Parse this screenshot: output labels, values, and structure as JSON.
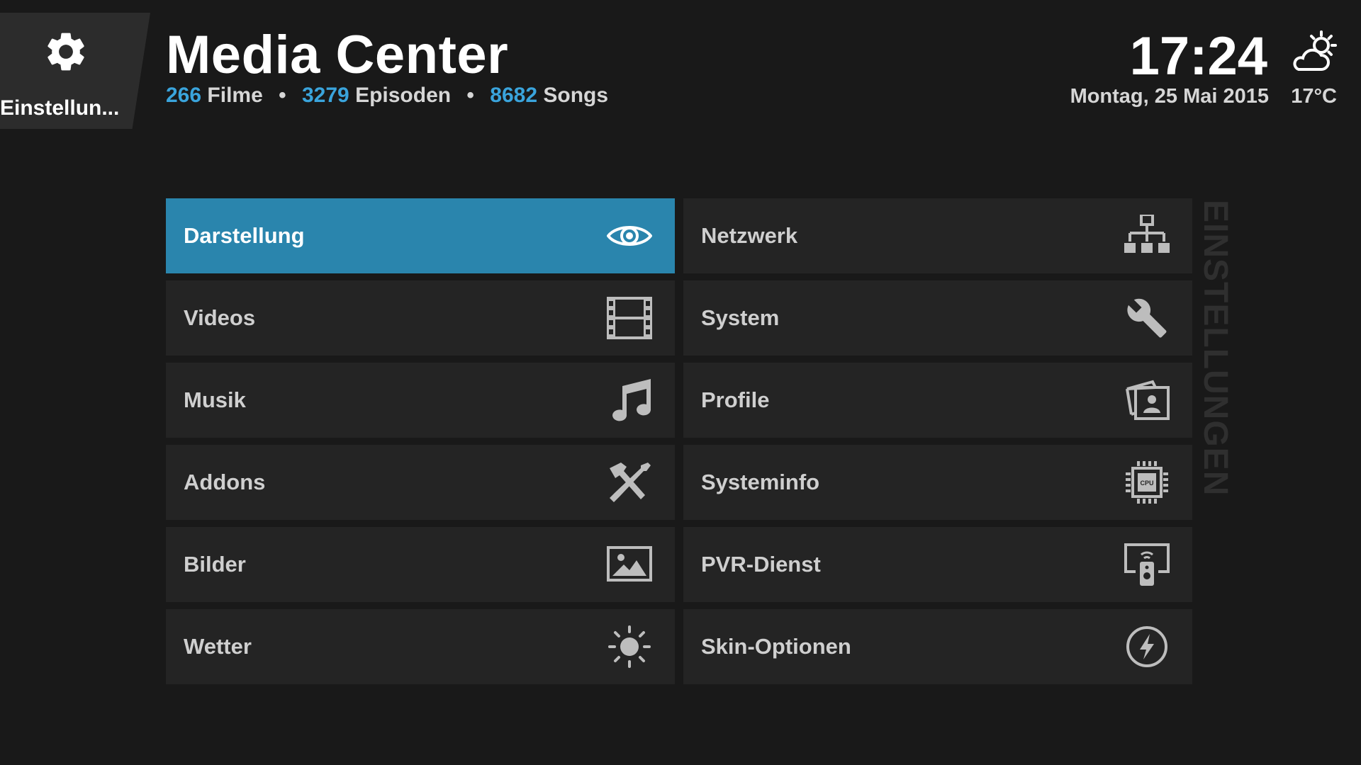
{
  "back_tab": {
    "label": "Einstellun...",
    "icon": "gear-icon"
  },
  "header": {
    "title": "Media Center",
    "stats": [
      {
        "count": "266",
        "label": "Filme"
      },
      {
        "count": "3279",
        "label": "Episoden"
      },
      {
        "count": "8682",
        "label": "Songs"
      }
    ],
    "separator": "•",
    "time": "17:24",
    "date": "Montag, 25 Mai 2015",
    "temperature": "17°C",
    "weather_icon": "partly-cloudy-icon"
  },
  "side_label": "EINSTELLUNGEN",
  "tiles": [
    {
      "label": "Darstellung",
      "icon": "eye-icon",
      "active": true
    },
    {
      "label": "Netzwerk",
      "icon": "network-icon"
    },
    {
      "label": "Videos",
      "icon": "film-icon"
    },
    {
      "label": "System",
      "icon": "wrench-icon"
    },
    {
      "label": "Musik",
      "icon": "music-note-icon"
    },
    {
      "label": "Profile",
      "icon": "profile-icon"
    },
    {
      "label": "Addons",
      "icon": "tools-icon"
    },
    {
      "label": "Systeminfo",
      "icon": "cpu-icon"
    },
    {
      "label": "Bilder",
      "icon": "picture-icon"
    },
    {
      "label": "PVR-Dienst",
      "icon": "remote-icon"
    },
    {
      "label": "Wetter",
      "icon": "sun-icon"
    },
    {
      "label": "Skin-Optionen",
      "icon": "lightning-icon"
    }
  ],
  "colors": {
    "background": "#191919",
    "tile": "#242424",
    "accent": "#2a85ad",
    "count_highlight": "#3aa4dc"
  }
}
